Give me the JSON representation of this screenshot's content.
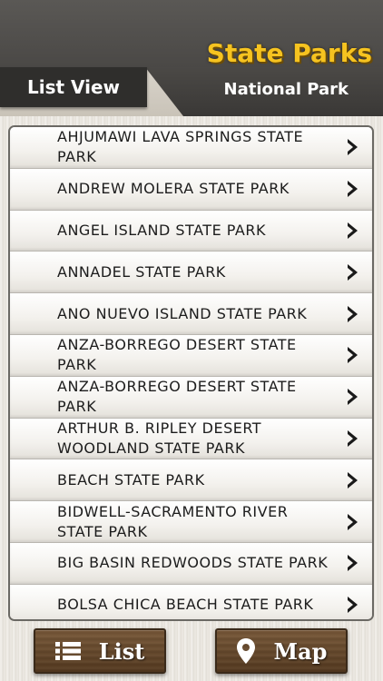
{
  "header": {
    "title": "State Parks",
    "subtitle": "National Park",
    "tab_label": "List View"
  },
  "parks": [
    {
      "name": "AHJUMAWI LAVA SPRINGS STATE PARK"
    },
    {
      "name": "ANDREW MOLERA STATE PARK"
    },
    {
      "name": "ANGEL ISLAND STATE PARK"
    },
    {
      "name": "ANNADEL STATE PARK"
    },
    {
      "name": "ANO NUEVO ISLAND STATE PARK"
    },
    {
      "name": "ANZA-BORREGO DESERT STATE PARK"
    },
    {
      "name": "ANZA-BORREGO DESERT STATE PARK"
    },
    {
      "name": "ARTHUR B. RIPLEY DESERT WOODLAND STATE PARK"
    },
    {
      "name": "BEACH STATE PARK"
    },
    {
      "name": "BIDWELL-SACRAMENTO RIVER STATE PARK"
    },
    {
      "name": "BIG BASIN REDWOODS STATE PARK"
    },
    {
      "name": "BOLSA CHICA BEACH STATE PARK"
    }
  ],
  "buttons": {
    "list_label": "List",
    "map_label": "Map"
  },
  "icons": {
    "row_chevron": "chevron-right-icon",
    "list": "list-icon",
    "map": "map-pin-icon"
  },
  "colors": {
    "title": "#f6c320",
    "header_dark": "#3f3d3b",
    "button_wood": "#6a4b2e"
  }
}
